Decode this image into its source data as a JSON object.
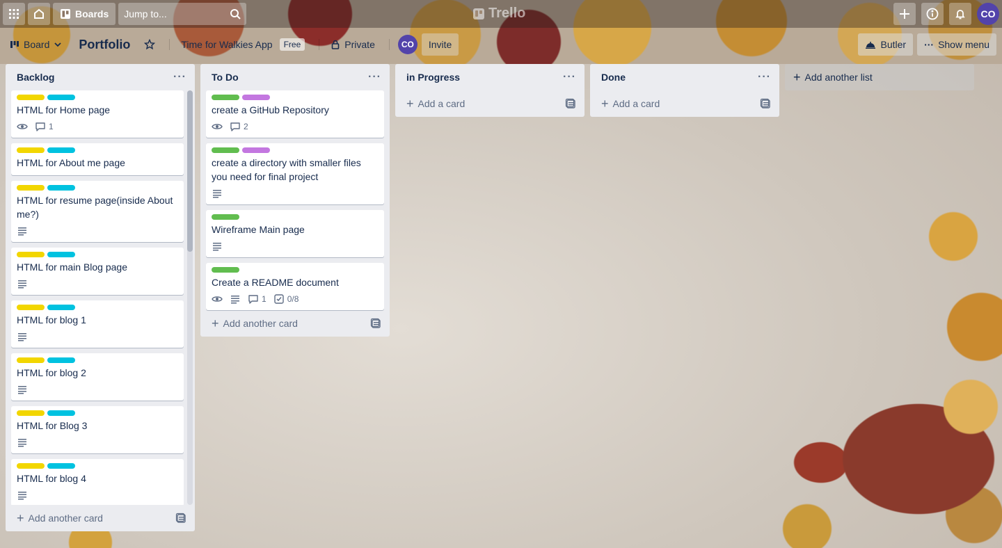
{
  "topnav": {
    "apps_icon": "grid-icon",
    "home_icon": "home-icon",
    "boards_label": "Boards",
    "search_placeholder": "Jump to...",
    "logo_text": "Trello",
    "avatar_initials": "CO"
  },
  "header": {
    "board_menu_label": "Board",
    "board_title": "Portfolio",
    "workspace_name": "Time for Walkies App",
    "workspace_badge": "Free",
    "visibility_label": "Private",
    "member_initials": "CO",
    "invite_label": "Invite",
    "butler_label": "Butler",
    "show_menu_label": "Show menu"
  },
  "colors": {
    "yellow": "#f2d600",
    "cyan": "#00c2e0",
    "green": "#61bd4f",
    "purple": "#c377e0",
    "avatar": "#5243aa"
  },
  "lists": [
    {
      "title": "Backlog",
      "add_label": "Add another card",
      "cards": [
        {
          "title": "HTML for Home page",
          "labels": [
            "yellow",
            "cyan"
          ],
          "watch": true,
          "comments": "1"
        },
        {
          "title": "HTML for About me page",
          "labels": [
            "yellow",
            "cyan"
          ]
        },
        {
          "title": "HTML for resume page(inside About me?)",
          "labels": [
            "yellow",
            "cyan"
          ],
          "description": true
        },
        {
          "title": "HTML for main Blog page",
          "labels": [
            "yellow",
            "cyan"
          ],
          "description": true
        },
        {
          "title": "HTML for blog 1",
          "labels": [
            "yellow",
            "cyan"
          ],
          "description": true
        },
        {
          "title": "HTML for blog 2",
          "labels": [
            "yellow",
            "cyan"
          ],
          "description": true
        },
        {
          "title": "HTML for Blog 3",
          "labels": [
            "yellow",
            "cyan"
          ],
          "description": true
        },
        {
          "title": "HTML for blog 4",
          "labels": [
            "yellow",
            "cyan"
          ],
          "description": true
        }
      ]
    },
    {
      "title": "To Do",
      "add_label": "Add another card",
      "cards": [
        {
          "title": "create a GitHub Repository",
          "labels": [
            "green",
            "purple"
          ],
          "watch": true,
          "comments": "2"
        },
        {
          "title": "create a directory with smaller files you need for final project",
          "labels": [
            "green",
            "purple"
          ],
          "description": true
        },
        {
          "title": "Wireframe Main page",
          "labels": [
            "green"
          ],
          "description": true
        },
        {
          "title": "Create a README document",
          "labels": [
            "green"
          ],
          "watch": true,
          "description": true,
          "comments": "1",
          "checklist": "0/8"
        }
      ]
    },
    {
      "title": "in Progress",
      "add_label": "Add a card",
      "cards": []
    },
    {
      "title": "Done",
      "add_label": "Add a card",
      "cards": []
    }
  ],
  "add_list_label": "Add another list"
}
